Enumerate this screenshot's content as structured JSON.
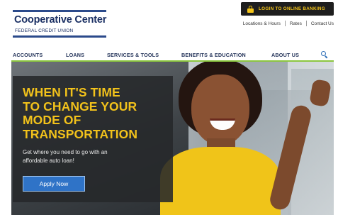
{
  "brand": {
    "name": "Cooperative Center",
    "subtitle": "FEDERAL CREDIT UNION"
  },
  "header": {
    "login_label": "LOGIN TO ONLINE BANKING",
    "utility_links": [
      "Locations & Hours",
      "Rates",
      "Contact Us"
    ]
  },
  "nav": {
    "items": [
      "ACCOUNTS",
      "LOANS",
      "SERVICES & TOOLS",
      "BENEFITS & EDUCATION",
      "ABOUT US"
    ],
    "search_icon": "search-icon"
  },
  "hero": {
    "headline": [
      "WHEN IT'S TIME",
      "TO CHANGE YOUR",
      "MODE OF",
      "TRANSPORTATION"
    ],
    "subtext": [
      "Get where you need to go with an",
      "affordable auto loan!"
    ],
    "cta_label": "Apply Now"
  },
  "colors": {
    "brand_blue": "#2b4a8b",
    "accent_yellow": "#f5c518",
    "nav_rule_green": "#8cc63f",
    "cta_blue": "#2f73c7"
  }
}
